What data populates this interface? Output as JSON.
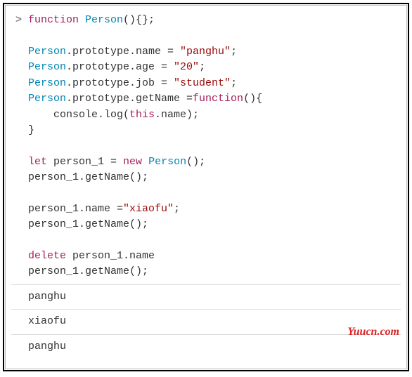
{
  "prompt": ">",
  "code": {
    "line1": {
      "kw": "function ",
      "name": "Person",
      "rest": "(){};"
    },
    "proto1": {
      "obj": "Person",
      "m": ".prototype.name = ",
      "str": "\"panghu\"",
      "end": ";"
    },
    "proto2": {
      "obj": "Person",
      "m": ".prototype.age = ",
      "str": "\"20\"",
      "end": ";"
    },
    "proto3": {
      "obj": "Person",
      "m": ".prototype.job = ",
      "str": "\"student\"",
      "end": ";"
    },
    "proto4": {
      "obj": "Person",
      "m": ".prototype.getName =",
      "kw": "function",
      "rest": "(){"
    },
    "consoleLog": {
      "pre": "console.log(",
      "this": "this",
      "mid": ".name);"
    },
    "closeBrace": "}",
    "letLine": {
      "kw": "let ",
      "var": "person_1 = ",
      "kw2": "new ",
      "call": "Person",
      "rest": "();"
    },
    "call1": "person_1.getName();",
    "assign": {
      "pre": "person_1.name =",
      "str": "\"xiaofu\"",
      "end": ";"
    },
    "call2": "person_1.getName();",
    "deleteLine": {
      "kw": "delete ",
      "rest": "person_1.name"
    },
    "call3": "person_1.getName();"
  },
  "output": [
    "panghu",
    "xiaofu",
    "panghu"
  ],
  "watermark": "Yuucn.com"
}
